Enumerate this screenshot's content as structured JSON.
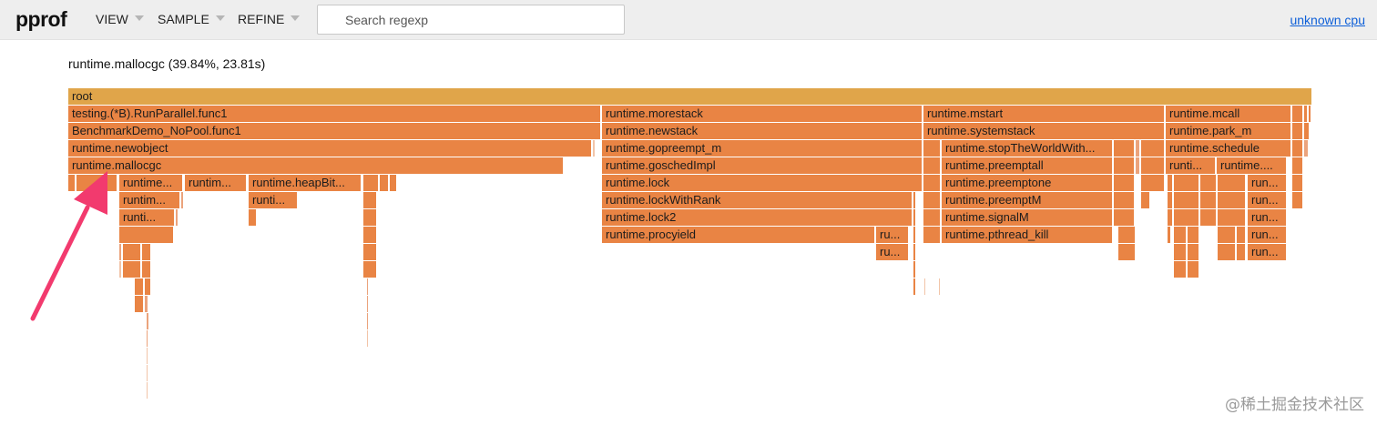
{
  "app": {
    "logo": "pprof"
  },
  "menu": {
    "view": "VIEW",
    "sample": "SAMPLE",
    "refine": "REFINE"
  },
  "search": {
    "placeholder": "Search regexp"
  },
  "header": {
    "sample_type_link": "unknown cpu"
  },
  "details": {
    "text": "runtime.mallocgc (39.84%, 23.81s)"
  },
  "frames": {
    "root": "root",
    "run_parallel": "testing.(*B).RunParallel.func1",
    "benchmark_demo": "BenchmarkDemo_NoPool.func1",
    "newobject": "runtime.newobject",
    "mallocgc": "runtime.mallocgc",
    "mallocgc_child_1": "runtime...",
    "mallocgc_child_2": "runtim...",
    "heap_bits": "runtime.heapBit...",
    "mallocgc_grandchild_1": "runtim...",
    "mallocgc_grandchild_2": "runti...",
    "mallocgc_great_1": "runti...",
    "morestack": "runtime.morestack",
    "newstack": "runtime.newstack",
    "gopreempt": "runtime.gopreempt_m",
    "goschedimpl": "runtime.goschedImpl",
    "lock": "runtime.lock",
    "lock_with_rank": "runtime.lockWithRank",
    "lock2": "runtime.lock2",
    "procyield": "runtime.procyield",
    "procyield_side_1": "ru...",
    "procyield_side_2": "ru...",
    "mstart": "runtime.mstart",
    "systemstack": "runtime.systemstack",
    "stop_the_world": "runtime.stopTheWorldWith...",
    "preemptall": "runtime.preemptall",
    "preemptone": "runtime.preemptone",
    "preempt_m": "runtime.preemptM",
    "signal_m": "runtime.signalM",
    "pthread_kill": "runtime.pthread_kill",
    "mcall": "runtime.mcall",
    "park_m": "runtime.park_m",
    "schedule": "runtime.schedule",
    "schedule_child_1": "runti...",
    "schedule_child_2": "runtime....",
    "schedule_right_1": "run...",
    "schedule_right_2": "run...",
    "schedule_right_3": "run...",
    "schedule_right_4": "run...",
    "schedule_right_5": "run..."
  },
  "watermark": "@稀土掘金技术社区",
  "colors": {
    "root": "#e0a54a",
    "frame": "#e98444",
    "annotation_arrow": "#f23a6e",
    "link": "#0d5fd8"
  },
  "icons": {
    "dropdown": "caret-down-icon",
    "annotation": "arrow-annotation-icon"
  }
}
